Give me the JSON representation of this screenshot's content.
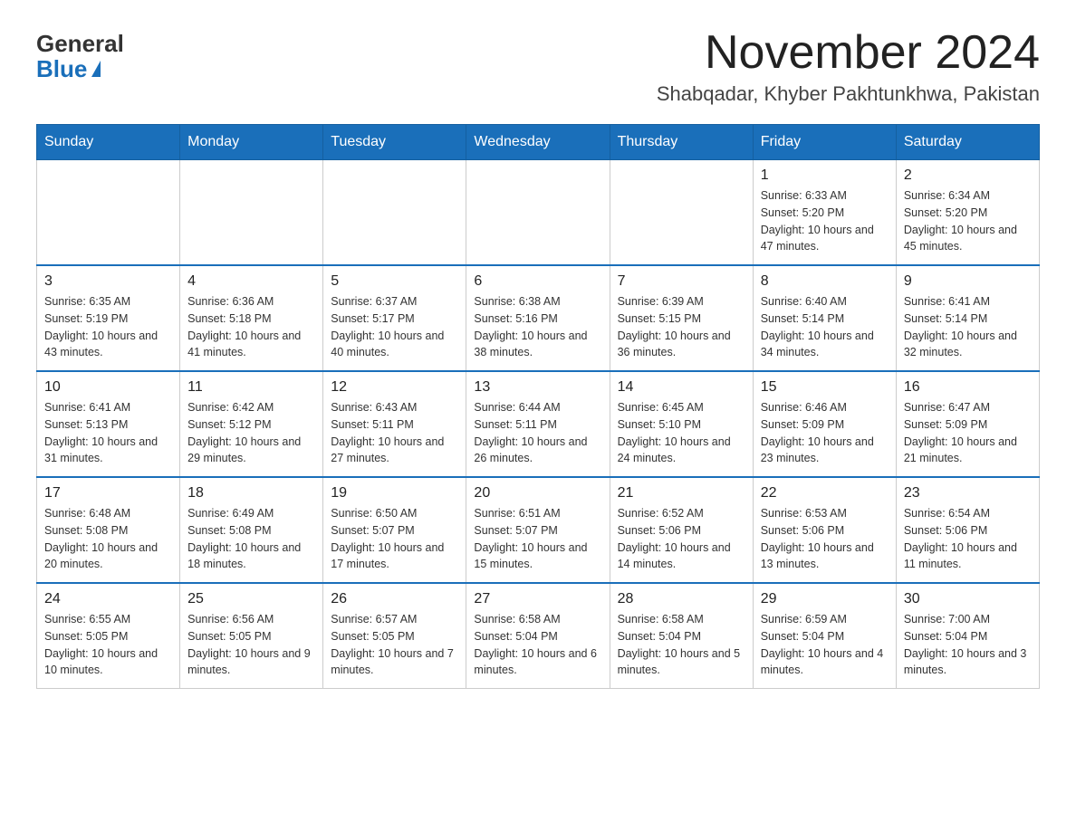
{
  "header": {
    "logo_general": "General",
    "logo_blue": "Blue",
    "month_year": "November 2024",
    "location": "Shabqadar, Khyber Pakhtunkhwa, Pakistan"
  },
  "weekdays": [
    "Sunday",
    "Monday",
    "Tuesday",
    "Wednesday",
    "Thursday",
    "Friday",
    "Saturday"
  ],
  "weeks": [
    [
      {
        "day": "",
        "info": ""
      },
      {
        "day": "",
        "info": ""
      },
      {
        "day": "",
        "info": ""
      },
      {
        "day": "",
        "info": ""
      },
      {
        "day": "",
        "info": ""
      },
      {
        "day": "1",
        "info": "Sunrise: 6:33 AM\nSunset: 5:20 PM\nDaylight: 10 hours and 47 minutes."
      },
      {
        "day": "2",
        "info": "Sunrise: 6:34 AM\nSunset: 5:20 PM\nDaylight: 10 hours and 45 minutes."
      }
    ],
    [
      {
        "day": "3",
        "info": "Sunrise: 6:35 AM\nSunset: 5:19 PM\nDaylight: 10 hours and 43 minutes."
      },
      {
        "day": "4",
        "info": "Sunrise: 6:36 AM\nSunset: 5:18 PM\nDaylight: 10 hours and 41 minutes."
      },
      {
        "day": "5",
        "info": "Sunrise: 6:37 AM\nSunset: 5:17 PM\nDaylight: 10 hours and 40 minutes."
      },
      {
        "day": "6",
        "info": "Sunrise: 6:38 AM\nSunset: 5:16 PM\nDaylight: 10 hours and 38 minutes."
      },
      {
        "day": "7",
        "info": "Sunrise: 6:39 AM\nSunset: 5:15 PM\nDaylight: 10 hours and 36 minutes."
      },
      {
        "day": "8",
        "info": "Sunrise: 6:40 AM\nSunset: 5:14 PM\nDaylight: 10 hours and 34 minutes."
      },
      {
        "day": "9",
        "info": "Sunrise: 6:41 AM\nSunset: 5:14 PM\nDaylight: 10 hours and 32 minutes."
      }
    ],
    [
      {
        "day": "10",
        "info": "Sunrise: 6:41 AM\nSunset: 5:13 PM\nDaylight: 10 hours and 31 minutes."
      },
      {
        "day": "11",
        "info": "Sunrise: 6:42 AM\nSunset: 5:12 PM\nDaylight: 10 hours and 29 minutes."
      },
      {
        "day": "12",
        "info": "Sunrise: 6:43 AM\nSunset: 5:11 PM\nDaylight: 10 hours and 27 minutes."
      },
      {
        "day": "13",
        "info": "Sunrise: 6:44 AM\nSunset: 5:11 PM\nDaylight: 10 hours and 26 minutes."
      },
      {
        "day": "14",
        "info": "Sunrise: 6:45 AM\nSunset: 5:10 PM\nDaylight: 10 hours and 24 minutes."
      },
      {
        "day": "15",
        "info": "Sunrise: 6:46 AM\nSunset: 5:09 PM\nDaylight: 10 hours and 23 minutes."
      },
      {
        "day": "16",
        "info": "Sunrise: 6:47 AM\nSunset: 5:09 PM\nDaylight: 10 hours and 21 minutes."
      }
    ],
    [
      {
        "day": "17",
        "info": "Sunrise: 6:48 AM\nSunset: 5:08 PM\nDaylight: 10 hours and 20 minutes."
      },
      {
        "day": "18",
        "info": "Sunrise: 6:49 AM\nSunset: 5:08 PM\nDaylight: 10 hours and 18 minutes."
      },
      {
        "day": "19",
        "info": "Sunrise: 6:50 AM\nSunset: 5:07 PM\nDaylight: 10 hours and 17 minutes."
      },
      {
        "day": "20",
        "info": "Sunrise: 6:51 AM\nSunset: 5:07 PM\nDaylight: 10 hours and 15 minutes."
      },
      {
        "day": "21",
        "info": "Sunrise: 6:52 AM\nSunset: 5:06 PM\nDaylight: 10 hours and 14 minutes."
      },
      {
        "day": "22",
        "info": "Sunrise: 6:53 AM\nSunset: 5:06 PM\nDaylight: 10 hours and 13 minutes."
      },
      {
        "day": "23",
        "info": "Sunrise: 6:54 AM\nSunset: 5:06 PM\nDaylight: 10 hours and 11 minutes."
      }
    ],
    [
      {
        "day": "24",
        "info": "Sunrise: 6:55 AM\nSunset: 5:05 PM\nDaylight: 10 hours and 10 minutes."
      },
      {
        "day": "25",
        "info": "Sunrise: 6:56 AM\nSunset: 5:05 PM\nDaylight: 10 hours and 9 minutes."
      },
      {
        "day": "26",
        "info": "Sunrise: 6:57 AM\nSunset: 5:05 PM\nDaylight: 10 hours and 7 minutes."
      },
      {
        "day": "27",
        "info": "Sunrise: 6:58 AM\nSunset: 5:04 PM\nDaylight: 10 hours and 6 minutes."
      },
      {
        "day": "28",
        "info": "Sunrise: 6:58 AM\nSunset: 5:04 PM\nDaylight: 10 hours and 5 minutes."
      },
      {
        "day": "29",
        "info": "Sunrise: 6:59 AM\nSunset: 5:04 PM\nDaylight: 10 hours and 4 minutes."
      },
      {
        "day": "30",
        "info": "Sunrise: 7:00 AM\nSunset: 5:04 PM\nDaylight: 10 hours and 3 minutes."
      }
    ]
  ]
}
